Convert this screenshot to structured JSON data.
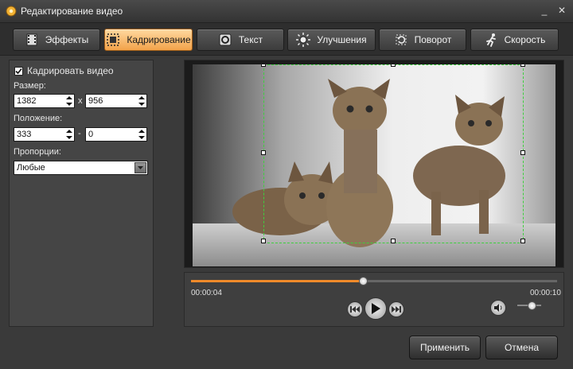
{
  "window": {
    "title": "Редактирование видео",
    "minimize": "_",
    "close": "✕"
  },
  "tabs": [
    {
      "label": "Эффекты",
      "icon": "film-effects-icon",
      "active": false
    },
    {
      "label": "Кадрирование",
      "icon": "crop-icon",
      "active": true
    },
    {
      "label": "Текст",
      "icon": "text-icon",
      "active": false
    },
    {
      "label": "Улучшения",
      "icon": "sun-enhance-icon",
      "active": false
    },
    {
      "label": "Поворот",
      "icon": "rotate-icon",
      "active": false
    },
    {
      "label": "Скорость",
      "icon": "running-man-icon",
      "active": false
    }
  ],
  "crop_panel": {
    "crop_checkbox_label": "Кадрировать видео",
    "crop_checked": true,
    "size_label": "Размер:",
    "width_value": "1382",
    "size_separator": "x",
    "height_value": "956",
    "position_label": "Положение:",
    "pos_x_value": "333",
    "position_separator": "-",
    "pos_y_value": "0",
    "proportions_label": "Пропорции:",
    "proportions_value": "Любые"
  },
  "player": {
    "current_time": "00:00:04",
    "total_time": "00:00:10",
    "progress": 0.47,
    "volume": 0.6,
    "accent_color": "#f08a2a"
  },
  "footer": {
    "apply_label": "Применить",
    "cancel_label": "Отмена"
  }
}
